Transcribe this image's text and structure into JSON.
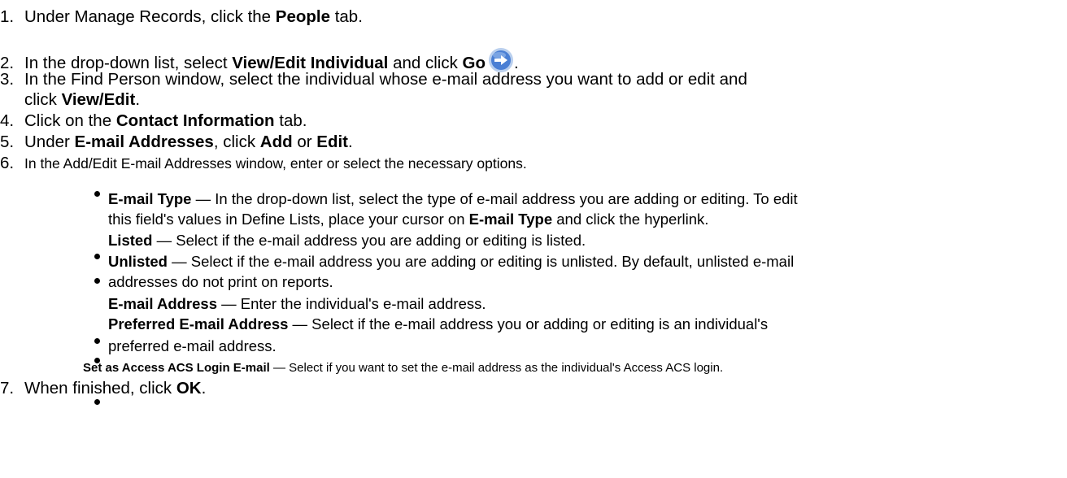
{
  "steps": [
    {
      "num": "1.",
      "pre": "Under Manage Records, click the ",
      "b1": "People",
      "post": " tab."
    },
    {
      "num": "2.",
      "pre": "In the drop-down list, select ",
      "b1": "View/Edit Individual",
      "mid": " and click ",
      "b2": "Go",
      "post": ".",
      "icon": "go-arrow-icon"
    },
    {
      "num": "3.",
      "pre": "In the Find Person window, select the individual whose e-mail address you want to add or edit and",
      "pre2": "click ",
      "b1": "View/Edit",
      "post": "."
    },
    {
      "num": "4.",
      "pre": "Click on the ",
      "b1": "Contact Information",
      "post": " tab."
    },
    {
      "num": "5.",
      "pre": "Under ",
      "b1": "E-mail Addresses",
      "mid": ", click ",
      "b2": "Add",
      "mid2": " or ",
      "b3": "Edit",
      "post": "."
    },
    {
      "num": "6.",
      "text": "In the Add/Edit E-mail Addresses window, enter or select the necessary options."
    },
    {
      "num": "7.",
      "pre": "When finished, click ",
      "b1": "OK",
      "post": "."
    }
  ],
  "options": [
    {
      "term": "E-mail Type",
      "line1": " — In the drop-down list, select the type of e-mail address you are adding or editing. To edit",
      "line2a": "this field's values in Define Lists, place your cursor on ",
      "line2b": "E-mail Type",
      "line2c": " and click the hyperlink."
    },
    {
      "term": "Listed",
      "line1": " — Select if the e-mail address you are adding or editing is listed."
    },
    {
      "term": "Unlisted",
      "line1": " — Select if the e-mail address you are adding or editing is unlisted. By default, unlisted e-mail",
      "line2": "addresses do not print on reports."
    },
    {
      "term": "E-mail Address",
      "line1": " — Enter the individual's e-mail address."
    },
    {
      "term": "Preferred E-mail Address",
      "line1": " — Select if the e-mail address you or adding or editing is an individual's",
      "line2": "preferred e-mail address."
    },
    {
      "term": "Set as Access ACS Login E-mail",
      "line1": " — Select if you want to set the e-mail address as the individual's Access ACS login."
    }
  ],
  "colors": {
    "go_icon_fill": "#4a7fd4",
    "go_icon_ring": "#b9cfee"
  }
}
